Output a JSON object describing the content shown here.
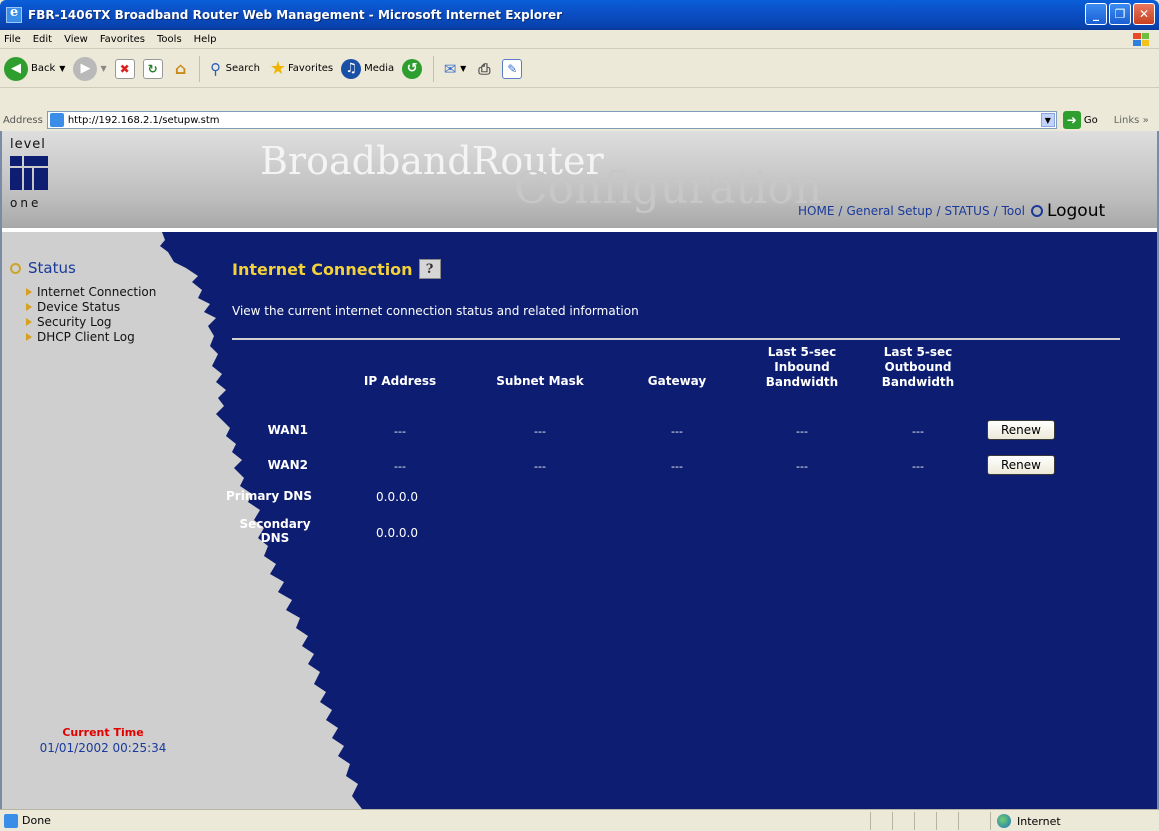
{
  "window": {
    "title": "FBR-1406TX Broadband Router Web Management - Microsoft Internet Explorer",
    "buttons": [
      "_",
      "❐",
      "✕"
    ]
  },
  "menu": [
    "File",
    "Edit",
    "View",
    "Favorites",
    "Tools",
    "Help"
  ],
  "toolbar": {
    "back_label": "Back",
    "search_label": "Search",
    "favorites_label": "Favorites",
    "media_label": "Media"
  },
  "address": {
    "label": "Address",
    "url": "http://192.168.2.1/setupw.stm",
    "go_label": "Go",
    "links_label": "Links"
  },
  "header": {
    "logo_top": "level",
    "logo_bottom": "one",
    "brand_line1": "BroadbandRouter",
    "brand_line2": "Configuration",
    "nav": {
      "home": "HOME",
      "general_setup": "General Setup",
      "status": "STATUS",
      "tool": "Tool",
      "separator": "/",
      "logout": "Logout"
    }
  },
  "sidebar": {
    "heading": "Status",
    "items": [
      {
        "label": "Internet Connection"
      },
      {
        "label": "Device Status"
      },
      {
        "label": "Security Log"
      },
      {
        "label": "DHCP Client Log"
      }
    ],
    "current_time_label": "Current Time",
    "current_time_value": "01/01/2002 00:25:34"
  },
  "main": {
    "title": "Internet Connection",
    "description": "View the current internet connection status and related information",
    "columns": {
      "ip": "IP Address",
      "subnet": "Subnet Mask",
      "gateway": "Gateway",
      "inbound": [
        "Last 5-sec",
        "Inbound",
        "Bandwidth"
      ],
      "outbound": [
        "Last 5-sec",
        "Outbound",
        "Bandwidth"
      ]
    },
    "rows": [
      {
        "label": "WAN1",
        "ip": "---",
        "subnet": "---",
        "gateway": "---",
        "inbound": "---",
        "outbound": "---",
        "button": "Renew"
      },
      {
        "label": "WAN2",
        "ip": "---",
        "subnet": "---",
        "gateway": "---",
        "inbound": "---",
        "outbound": "---",
        "button": "Renew"
      }
    ],
    "dns": {
      "primary_label": "Primary DNS",
      "primary_value": "0.0.0.0",
      "secondary_label_1": "Secondary",
      "secondary_label_2": "DNS",
      "secondary_value": "0.0.0.0"
    }
  },
  "statusbar": {
    "text": "Done",
    "zone": "Internet"
  },
  "colors": {
    "page_bg": "#0c1d72",
    "title_yellow": "#f2d13b",
    "current_time_red": "#e00000",
    "nav_blue": "#1a3a9a"
  }
}
